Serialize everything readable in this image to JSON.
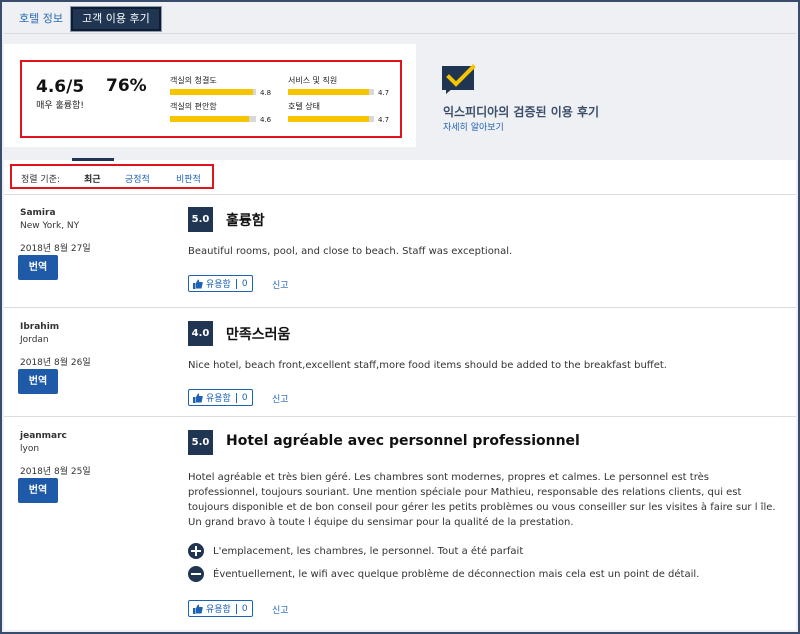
{
  "tabs": [
    {
      "label": "호텔 정보"
    },
    {
      "label": "고객 이용 후기"
    }
  ],
  "summary": {
    "score": "4.6/5",
    "score_text": "매우 훌륭함!",
    "recommend_pct": "76%",
    "categories": [
      {
        "label": "객실의 청결도",
        "value": "4.8",
        "rating": 4.8
      },
      {
        "label": "서비스 및 직원",
        "value": "4.7",
        "rating": 4.7
      },
      {
        "label": "객실의 편안함",
        "value": "4.6",
        "rating": 4.6
      },
      {
        "label": "호텔 상태",
        "value": "4.7",
        "rating": 4.7
      }
    ]
  },
  "verified": {
    "title": "익스피디아의 검증된 이용 후기",
    "link": "자세히 알아보기"
  },
  "sort": {
    "label": "정렬 기준:",
    "options": [
      "최근",
      "긍정적",
      "비판적"
    ]
  },
  "reviews": [
    {
      "name": "Samira",
      "location": "New York, NY",
      "date": "2018년 8월 27일",
      "translate": "번역",
      "rating": "5.0",
      "title": "훌륭함",
      "body": "Beautiful rooms, pool, and close to beach. Staff was exceptional.",
      "helpful": "유용함",
      "helpful_count": "0",
      "report": "신고"
    },
    {
      "name": "Ibrahim",
      "location": "Jordan",
      "date": "2018년 8월 26일",
      "translate": "번역",
      "rating": "4.0",
      "title": "만족스러움",
      "body": "Nice hotel, beach front,excellent staff,more food items should be added to the breakfast buffet.",
      "helpful": "유용함",
      "helpful_count": "0",
      "report": "신고"
    },
    {
      "name": "jeanmarc",
      "location": "lyon",
      "date": "2018년 8월 25일",
      "translate": "번역",
      "rating": "5.0",
      "title": "Hotel agréable avec personnel professionnel",
      "body": "Hotel agréable et très bien géré. Les chambres sont modernes, propres et calmes. Le personnel est très professionnel, toujours souriant. Une mention spéciale pour Mathieu, responsable des relations clients, qui est toujours disponible et de bon conseil pour gérer les petits problèmes ou vous conseiller sur les visites à faire sur l île. Un grand bravo à toute l équipe du sensimar pour la qualité de la prestation.",
      "pro": "L'emplacement, les chambres, le personnel. Tout a été parfait",
      "con": "Éventuellement, le wifi avec quelque problème de déconnection mais cela est un point de détail.",
      "helpful": "유용함",
      "helpful_count": "0",
      "report": "신고"
    }
  ]
}
